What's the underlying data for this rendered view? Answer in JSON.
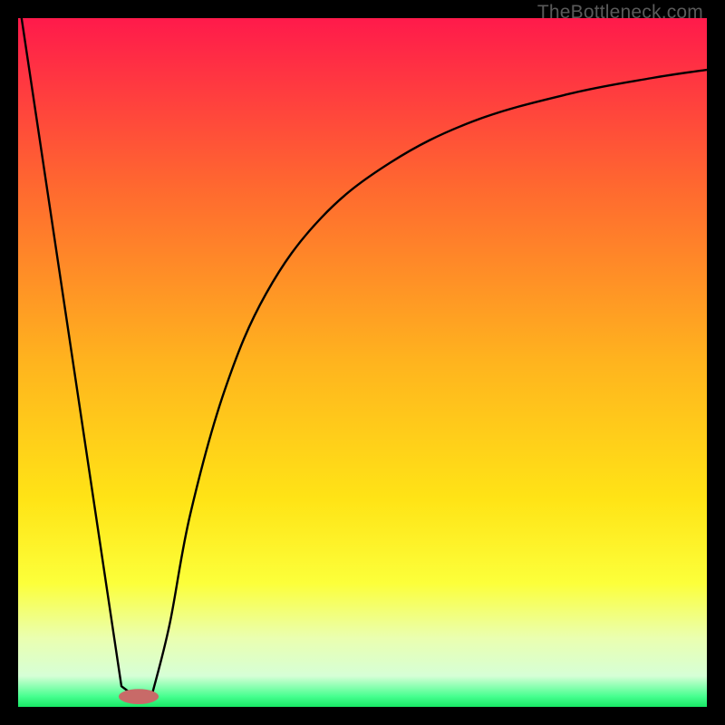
{
  "watermark": "TheBottleneck.com",
  "chart_data": {
    "type": "line",
    "title": "",
    "xlabel": "",
    "ylabel": "",
    "xlim": [
      0,
      100
    ],
    "ylim": [
      0,
      100
    ],
    "grid": false,
    "legend": false,
    "annotations": [],
    "gradient_stops": [
      {
        "pos": 0.0,
        "color": "#ff1a4b"
      },
      {
        "pos": 0.25,
        "color": "#ff6a2f"
      },
      {
        "pos": 0.5,
        "color": "#ffb41e"
      },
      {
        "pos": 0.7,
        "color": "#ffe416"
      },
      {
        "pos": 0.82,
        "color": "#fcff3a"
      },
      {
        "pos": 0.9,
        "color": "#eaffb0"
      },
      {
        "pos": 0.955,
        "color": "#d6ffd6"
      },
      {
        "pos": 0.985,
        "color": "#46ff8f"
      },
      {
        "pos": 1.0,
        "color": "#18e865"
      }
    ],
    "series": [
      {
        "name": "left-slope",
        "x": [
          0.5,
          15,
          17
        ],
        "y": [
          100,
          3,
          1.5
        ]
      },
      {
        "name": "right-curve",
        "x": [
          19.5,
          22,
          25,
          30,
          36,
          44,
          54,
          66,
          80,
          92,
          100
        ],
        "y": [
          2,
          12,
          28,
          46,
          60,
          71,
          79,
          85,
          89,
          91.3,
          92.5
        ]
      }
    ],
    "valley_marker": {
      "x": 17.5,
      "y": 1.5,
      "rx": 2.9,
      "ry": 1.1,
      "color": "#c86a68"
    }
  }
}
